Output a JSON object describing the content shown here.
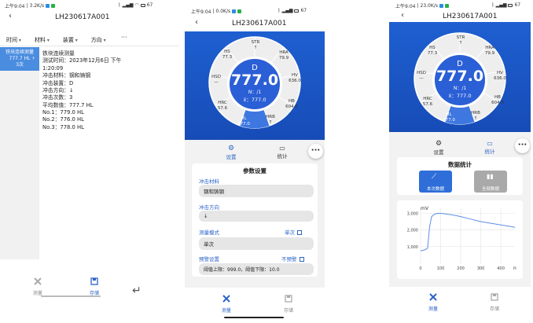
{
  "phone1": {
    "status": {
      "time": "上午9:04",
      "speed": "3.2K/s",
      "battery": "67"
    },
    "title": "LH230617A001",
    "filters": [
      "时间",
      "材料",
      "装置",
      "方向"
    ],
    "record": {
      "name": "铁块连续测量",
      "value": "777.7 HL",
      "count": "3次"
    },
    "details": [
      "铁块连续测量",
      "测试时间：2023年12月6日 下午",
      "1:20:09",
      "冲击材料：钢和铸钢",
      "冲击装置：D",
      "冲击方向：↓",
      "冲击次数：3",
      "平均数值：777.7 HL",
      "No.1：779.0 HL",
      "No.2：776.0 HL",
      "No.3：778.0 HL"
    ],
    "nav": {
      "measure": "测量",
      "storage": "存储"
    },
    "back_key": "↵"
  },
  "phone2": {
    "status": {
      "time": "上午9:04",
      "speed": "0.0K/s",
      "battery": "67"
    },
    "title": "LH230617A001",
    "dial": {
      "device": "D",
      "value": "777.0",
      "n": "N：/1",
      "avg": "x̄：777.0",
      "segments": [
        {
          "name": "STR",
          "v": "↑"
        },
        {
          "name": "HRA",
          "v": "79.9"
        },
        {
          "name": "HV",
          "v": "636.0"
        },
        {
          "name": "HB",
          "v": "604.0"
        },
        {
          "name": "HRB",
          "v": "↑"
        },
        {
          "name": "HL",
          "v": "777.0"
        },
        {
          "name": "HRC",
          "v": "57.6"
        },
        {
          "name": "HSD",
          "v": "—"
        },
        {
          "name": "HS",
          "v": "77.3"
        }
      ]
    },
    "tabs": {
      "settings": "设置",
      "stats": "统计"
    },
    "params": {
      "title": "参数设置",
      "material_label": "冲击材料",
      "material": "钢和铸钢",
      "direction_label": "冲击方向",
      "direction": "↓",
      "mode_label": "测量模式",
      "mode_opt": "单次",
      "mode": "单次",
      "warn_label": "预警设置",
      "warn_opt": "不预警",
      "warn": "阈值上限：999.0，阈值下限：10.0"
    },
    "nav": {
      "measure": "测量",
      "storage": "存储"
    }
  },
  "phone3": {
    "status": {
      "time": "上午9:04",
      "speed": "23.0K/s",
      "battery": "67"
    },
    "title": "LH230617A001",
    "dial": {
      "device": "D",
      "value": "777.0",
      "n": "N：/1",
      "avg": "x̄：777.0",
      "segments": [
        {
          "name": "STR",
          "v": "↑"
        },
        {
          "name": "HRA",
          "v": "79.9"
        },
        {
          "name": "HV",
          "v": "636.0"
        },
        {
          "name": "HB",
          "v": "604.0"
        },
        {
          "name": "HRB",
          "v": "↑"
        },
        {
          "name": "HL",
          "v": "777.0"
        },
        {
          "name": "HRC",
          "v": "57.6"
        },
        {
          "name": "HSD",
          "v": "—"
        },
        {
          "name": "HS",
          "v": "77.3"
        }
      ]
    },
    "tabs": {
      "settings": "设置",
      "stats": "统计"
    },
    "stats": {
      "title": "数据统计",
      "btn_current": "本次数据",
      "btn_all": "全部数据"
    },
    "chart_data": {
      "type": "line",
      "ylabel": "mV",
      "xlabel": "n",
      "y_ticks": [
        "3,000",
        "2,000",
        "1,000"
      ],
      "x_ticks": [
        "0",
        "100",
        "200",
        "300",
        "400"
      ],
      "xlim": [
        0,
        470
      ],
      "ylim": [
        0,
        3300
      ],
      "series": [
        {
          "x": [
            0,
            20,
            35,
            45,
            55,
            70,
            90,
            110,
            130,
            160,
            200,
            250,
            300,
            350,
            400,
            450,
            470
          ],
          "y": [
            750,
            800,
            900,
            2200,
            2800,
            2950,
            3000,
            2980,
            2950,
            2900,
            2800,
            2650,
            2500,
            2400,
            2300,
            2200,
            2150
          ]
        }
      ]
    },
    "nav": {
      "measure": "测量",
      "storage": "存储"
    }
  }
}
